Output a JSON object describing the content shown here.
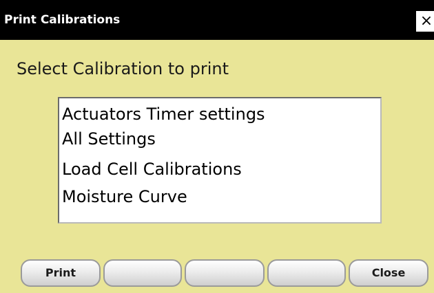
{
  "window": {
    "title": "Print Calibrations",
    "close_glyph": "×"
  },
  "prompt": "Select Calibration to print",
  "calibrations": [
    "Actuators Timer settings",
    "All Settings",
    "Load Cell Calibrations",
    "Moisture Curve"
  ],
  "buttons": {
    "print": "Print",
    "close": "Close"
  },
  "colors": {
    "dialog_background": "#e9e597",
    "titlebar_background": "#000000"
  }
}
